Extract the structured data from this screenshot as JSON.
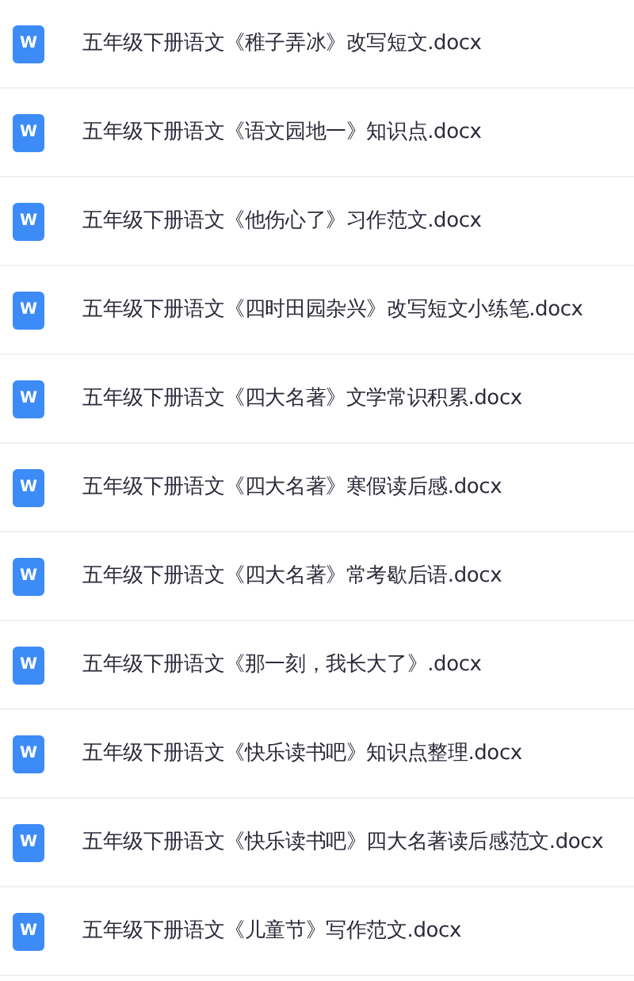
{
  "files": [
    {
      "icon_letter": "W",
      "name": "五年级下册语文《稚子弄冰》改写短文.docx"
    },
    {
      "icon_letter": "W",
      "name": "五年级下册语文《语文园地一》知识点.docx"
    },
    {
      "icon_letter": "W",
      "name": "五年级下册语文《他伤心了》习作范文.docx"
    },
    {
      "icon_letter": "W",
      "name": "五年级下册语文《四时田园杂兴》改写短文小练笔.docx"
    },
    {
      "icon_letter": "W",
      "name": "五年级下册语文《四大名著》文学常识积累.docx"
    },
    {
      "icon_letter": "W",
      "name": "五年级下册语文《四大名著》寒假读后感.docx"
    },
    {
      "icon_letter": "W",
      "name": "五年级下册语文《四大名著》常考歇后语.docx"
    },
    {
      "icon_letter": "W",
      "name": "五年级下册语文《那一刻，我长大了》.docx"
    },
    {
      "icon_letter": "W",
      "name": "五年级下册语文《快乐读书吧》知识点整理.docx"
    },
    {
      "icon_letter": "W",
      "name": "五年级下册语文《快乐读书吧》四大名著读后感范文.docx"
    },
    {
      "icon_letter": "W",
      "name": "五年级下册语文《儿童节》写作范文.docx"
    }
  ]
}
